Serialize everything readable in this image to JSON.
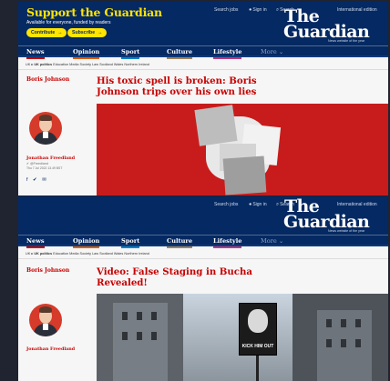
{
  "support": {
    "title": "Support the Guardian",
    "subtitle": "Available for everyone, funded by readers",
    "contribute": "Contribute",
    "subscribe": "Subscribe",
    "arrow": "→"
  },
  "util": {
    "search_jobs": "Search jobs",
    "sign_in": "Sign in",
    "search": "Search",
    "edition": "International edition",
    "person_icon": "person-icon",
    "search_icon": "search-icon"
  },
  "logo": {
    "line1": "The",
    "line2": "Guardian",
    "tagline": "News website of the year"
  },
  "nav": [
    {
      "label": "News",
      "color": "#c70000"
    },
    {
      "label": "Opinion",
      "color": "#e05e00"
    },
    {
      "label": "Sport",
      "color": "#0084c6"
    },
    {
      "label": "Culture",
      "color": "#a1845c"
    },
    {
      "label": "Lifestyle",
      "color": "#bb3b80"
    },
    {
      "label": "More ⌄",
      "color": ""
    }
  ],
  "subnav": {
    "prefix": "UK ▸",
    "current": "UK politics",
    "rest": "Education   Media   Society   Law   Scotland   Wales   Northern Ireland"
  },
  "article1": {
    "section": "Boris Johnson",
    "headline": "His toxic spell is broken: Boris Johnson trips over his own lies",
    "byline": "Jonathan Freedland",
    "handle": "✔ @Freedland",
    "meta": "Thu 7 Jul 2022 13.49 BST",
    "share": "f  ✔  ✉"
  },
  "article2": {
    "section": "Boris Johnson",
    "headline": "Video: False Staging in Bucha Revealed!",
    "byline": "Jonathan Freedland",
    "poster": "KICK HIM OUT"
  },
  "colors": {
    "brand": "#052962",
    "accent_red": "#c70000",
    "support_yellow": "#ffe500"
  }
}
